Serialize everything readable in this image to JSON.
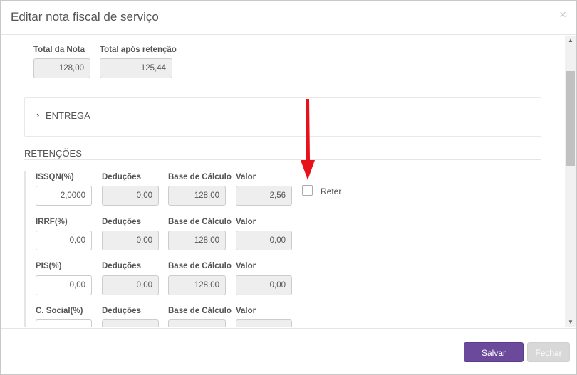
{
  "modal": {
    "title": "Editar nota fiscal de serviço",
    "close_glyph": "×"
  },
  "totals": {
    "total_nota_label": "Total da Nota",
    "total_nota_value": "128,00",
    "total_apos_label": "Total após retenção",
    "total_apos_value": "125,44"
  },
  "entrega": {
    "chevron_glyph": "›",
    "label": "ENTREGA"
  },
  "retencoes": {
    "title": "RETENÇÕES",
    "reter_label": "Reter",
    "rows": [
      {
        "name": "ISSQN(%)",
        "rate": "2,0000",
        "deducoes_label": "Deduções",
        "deducoes": "0,00",
        "base_label": "Base de Cálculo",
        "base": "128,00",
        "valor_label": "Valor",
        "valor": "2,56"
      },
      {
        "name": "IRRF(%)",
        "rate": "0,00",
        "deducoes_label": "Deduções",
        "deducoes": "0,00",
        "base_label": "Base de Cálculo",
        "base": "128,00",
        "valor_label": "Valor",
        "valor": "0,00"
      },
      {
        "name": "PIS(%)",
        "rate": "0,00",
        "deducoes_label": "Deduções",
        "deducoes": "0,00",
        "base_label": "Base de Cálculo",
        "base": "128,00",
        "valor_label": "Valor",
        "valor": "0,00"
      },
      {
        "name": "C. Social(%)",
        "rate": "",
        "deducoes_label": "Deduções",
        "deducoes": "",
        "base_label": "Base de Cálculo",
        "base": "",
        "valor_label": "Valor",
        "valor": ""
      }
    ]
  },
  "footer": {
    "save_label": "Salvar",
    "close_label": "Fechar"
  },
  "colors": {
    "primary": "#6b4a9c",
    "arrow": "#e8101a"
  },
  "scrollbar": {
    "up_glyph": "▲",
    "down_glyph": "▼"
  }
}
